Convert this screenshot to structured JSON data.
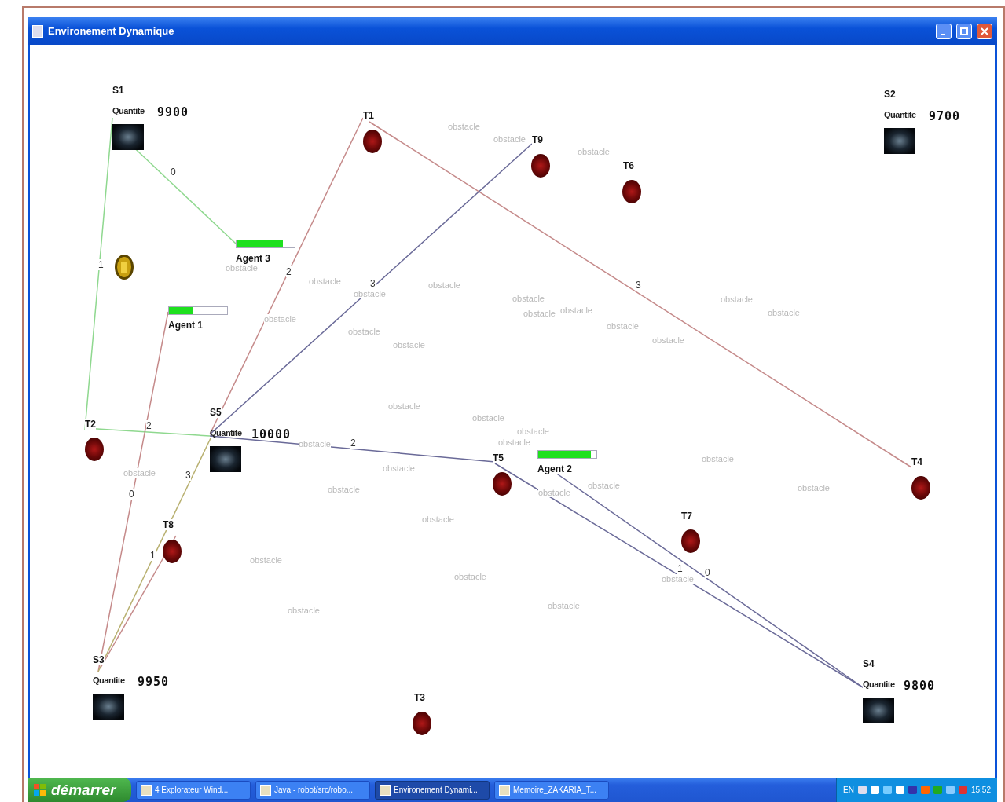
{
  "window": {
    "title": "Environement Dynamique"
  },
  "stations": [
    {
      "name": "S1",
      "quantity_label": "Quantite",
      "quantity": "9900"
    },
    {
      "name": "S2",
      "quantity_label": "Quantite",
      "quantity": "9700"
    },
    {
      "name": "S5",
      "quantity_label": "Quantite",
      "quantity": "10000"
    },
    {
      "name": "S3",
      "quantity_label": "Quantite",
      "quantity": "9950"
    },
    {
      "name": "S4",
      "quantity_label": "Quantite",
      "quantity": "9800"
    }
  ],
  "targets": [
    {
      "name": "T1"
    },
    {
      "name": "T9"
    },
    {
      "name": "T6"
    },
    {
      "name": "T2"
    },
    {
      "name": "T5"
    },
    {
      "name": "T4"
    },
    {
      "name": "T7"
    },
    {
      "name": "T8"
    },
    {
      "name": "T3"
    }
  ],
  "agents": [
    {
      "name": "Agent 3",
      "level": 0.8
    },
    {
      "name": "Agent 1",
      "level": 0.4
    },
    {
      "name": "Agent 2",
      "level": 0.9
    }
  ],
  "edges": [
    {
      "label": "0",
      "color": "#8fd88f"
    },
    {
      "label": "1",
      "color": "#8fd88f"
    },
    {
      "label": "2",
      "color": "#8fd88f"
    },
    {
      "label": "0",
      "color": "#c58a8a"
    },
    {
      "label": "3",
      "color": "#b8b070"
    },
    {
      "label": "1",
      "color": "#c58a8a"
    },
    {
      "label": "2",
      "color": "#c58a8a"
    },
    {
      "label": "3",
      "color": "#c58a8a"
    },
    {
      "label": "3",
      "color": "#6a6a98"
    },
    {
      "label": "2",
      "color": "#6a6a98"
    },
    {
      "label": "1",
      "color": "#6a6a98"
    },
    {
      "label": "0",
      "color": "#6a6a98"
    }
  ],
  "obstacles": [
    "obstacle",
    "obstacle",
    "obstacle",
    "obstacle",
    "obstacle",
    "obstacle",
    "obstacle",
    "obstacle",
    "obstacle",
    "obstacle",
    "obstacle",
    "obstacle",
    "obstacle",
    "obstacle",
    "obstacle",
    "obstacle",
    "obstacle",
    "obstacle",
    "obstacle",
    "obstacle",
    "obstacle",
    "obstacle",
    "obstacle",
    "obstacle",
    "obstacle",
    "obstacle",
    "obstacle",
    "obstacle",
    "obstacle",
    "obstacle",
    "obstacle",
    "obstacle",
    "obstacle",
    "obstacle",
    "obstacle"
  ],
  "taskbar": {
    "start": "démarrer",
    "tasks": [
      {
        "label": "4 Explorateur Wind...",
        "selected": false
      },
      {
        "label": "Java - robot/src/robo...",
        "selected": false
      },
      {
        "label": "Environement Dynami...",
        "selected": true
      },
      {
        "label": "Memoire_ZAKARIA_T...",
        "selected": false
      }
    ],
    "language": "EN",
    "clock": "15:52"
  }
}
